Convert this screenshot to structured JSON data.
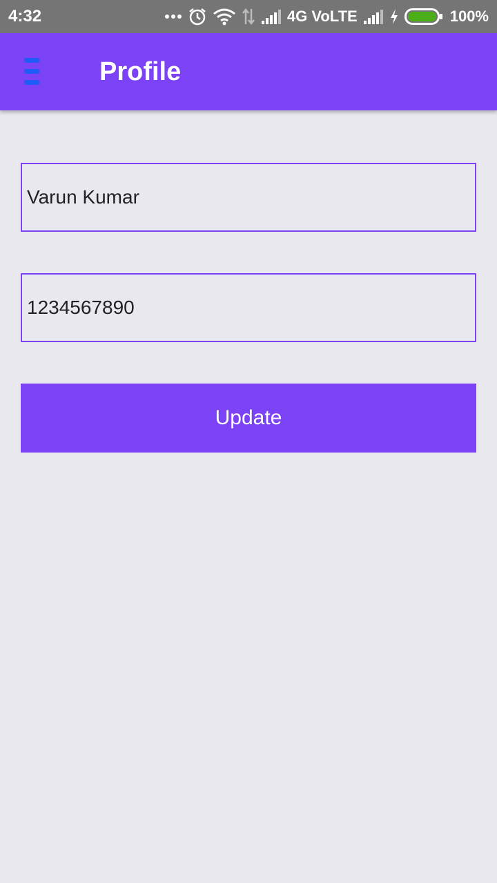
{
  "status_bar": {
    "time": "4:32",
    "network_label": "4G VoLTE",
    "battery_percent": "100%",
    "icons": [
      "more-dots-icon",
      "alarm-icon",
      "wifi-icon",
      "data-arrows-icon",
      "signal-icon",
      "signal-icon-2",
      "charging-icon",
      "battery-icon"
    ]
  },
  "app_bar": {
    "title": "Profile",
    "menu_icon": "hamburger-menu-icon"
  },
  "form": {
    "name_value": "Varun Kumar",
    "phone_value": "1234567890",
    "update_label": "Update"
  },
  "colors": {
    "accent": "#7c42f5",
    "menu_icon": "#1f5cf5",
    "background": "#e9e8ef",
    "status_bar": "#757575",
    "battery_fill": "#4caf1a"
  }
}
